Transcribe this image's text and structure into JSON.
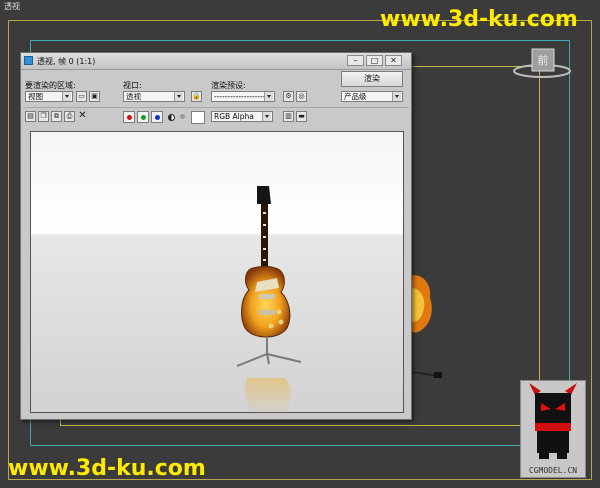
{
  "viewport": {
    "label": "透视"
  },
  "watermarks": {
    "top": "www.3d-ku.com",
    "bottom": "www.3d-ku.com",
    "logo_text": "CGMODEL.CN"
  },
  "viewcube": {
    "label": "前"
  },
  "render_window": {
    "title": "透视, 帧 0 (1:1)",
    "controls": {
      "area_label": "要渲染的区域:",
      "area_value": "视图",
      "viewport_label": "视口:",
      "viewport_value": "透视",
      "preset_label": "渲染预设:",
      "preset_value": "--------------------",
      "render_button": "渲染",
      "quality_value": "产品级",
      "channel_value": "RGB Alpha"
    },
    "colors": {
      "red": "#d01010",
      "green": "#18a018",
      "blue": "#1030c8",
      "accent_title": "#2f8fd8"
    }
  }
}
